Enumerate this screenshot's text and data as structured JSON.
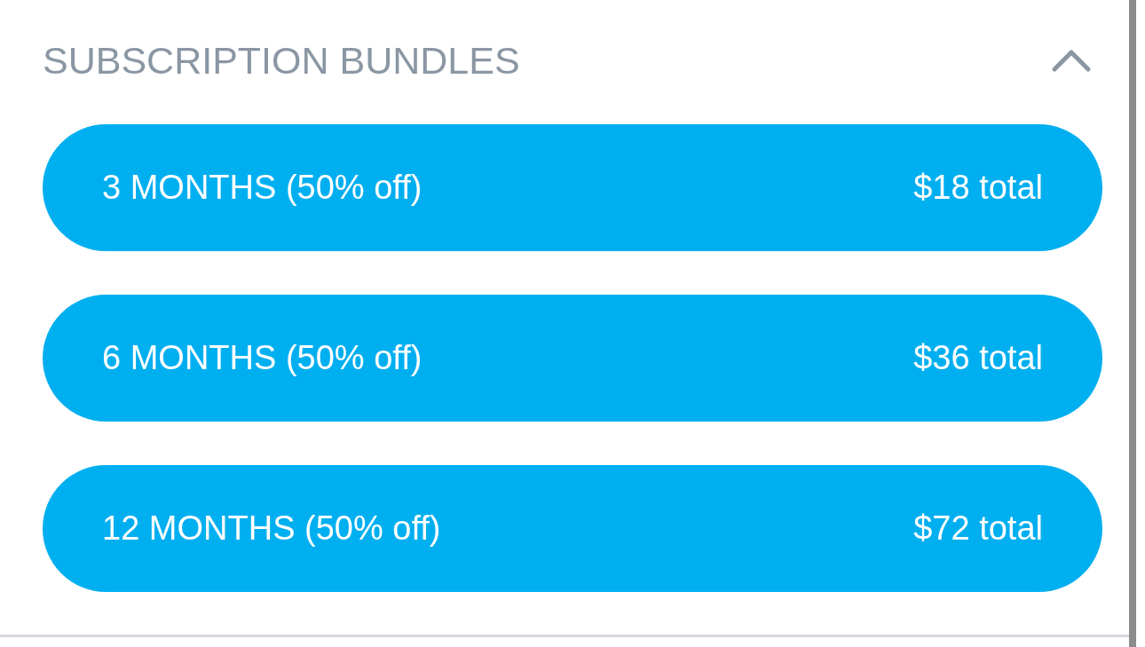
{
  "section": {
    "title": "SUBSCRIPTION BUNDLES",
    "expanded": true
  },
  "bundles": [
    {
      "label": "3 MONTHS (50% off)",
      "price": "$18 total"
    },
    {
      "label": "6 MONTHS (50% off)",
      "price": "$36 total"
    },
    {
      "label": "12 MONTHS (50% off)",
      "price": "$72 total"
    }
  ]
}
